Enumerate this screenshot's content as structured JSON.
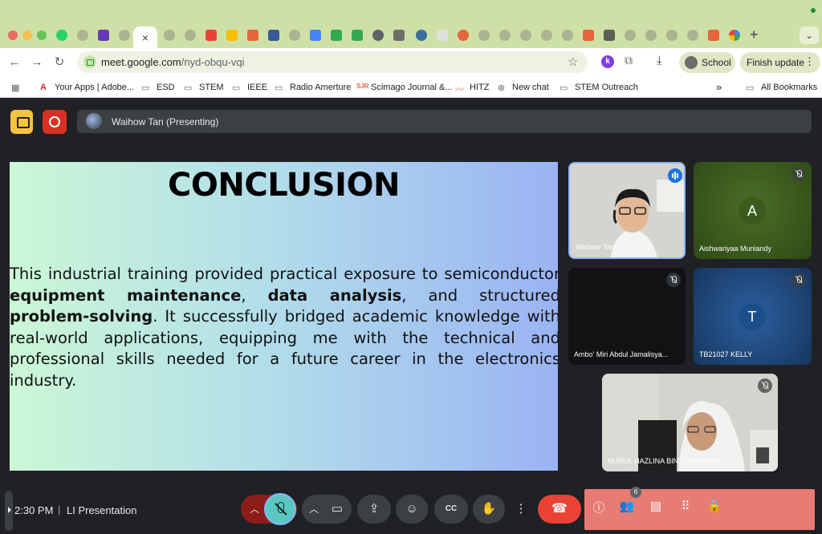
{
  "browser": {
    "url_host": "meet.google.com",
    "url_path": "/nyd-obqu-vqi",
    "profile_label": "School",
    "update_label": "Finish update",
    "bookmarks": [
      {
        "label": "Your Apps | Adobe..."
      },
      {
        "label": "ESD"
      },
      {
        "label": "STEM"
      },
      {
        "label": "IEEE"
      },
      {
        "label": "Radio Amerture"
      },
      {
        "label": "Scimago Journal &..."
      },
      {
        "label": "HITZ"
      },
      {
        "label": "New chat"
      },
      {
        "label": "STEM Outreach"
      }
    ],
    "all_bookmarks_label": "All Bookmarks",
    "overflow_label": "»"
  },
  "meet": {
    "presenter_label": "Waihow Tan (Presenting)",
    "slide": {
      "title": "CONCLUSION",
      "body_1": "This industrial training provided practical exposure to semiconductor ",
      "bold_1": "equipment maintenance",
      "body_2": ", ",
      "bold_2": "data analysis",
      "body_3": ", and structured ",
      "bold_3": "problem-solving",
      "body_4": ". It successfully bridged academic knowledge with real-world applications, equipping me with the technical and professional skills needed for a future career in the electronics industry."
    },
    "participants": [
      {
        "name": "Waihow Tan",
        "speaking": true
      },
      {
        "name": "Aishwariyaa Muniandy",
        "initial": "A",
        "muted": true,
        "color": "#3a5a1e"
      },
      {
        "name": "Ambo' Miri Abdul Jamalisya...",
        "muted": true
      },
      {
        "name": "TB21027 KELLY",
        "initial": "T",
        "muted": true,
        "color": "#1a4f8b"
      },
      {
        "name": "NURUL HAZLINA BINTI NOORDIN",
        "muted": true
      }
    ],
    "time": "2:30 PM",
    "separator": "|",
    "meeting_name": "LI Presentation",
    "people_count": "6"
  }
}
